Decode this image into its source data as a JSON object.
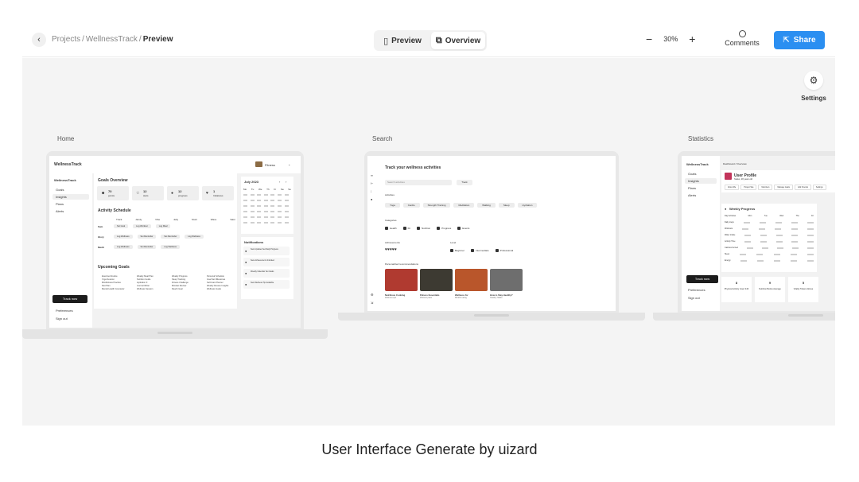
{
  "toolbar": {
    "breadcrumb": [
      "Projects",
      "WellnessTrack",
      "Preview"
    ],
    "separator": "/",
    "tabs": [
      {
        "label": "Preview",
        "icon": "phone-icon"
      },
      {
        "label": "Overview",
        "icon": "copy-icon"
      }
    ],
    "active_tab": "Overview",
    "zoom": "30%",
    "comments_label": "Comments",
    "share_label": "Share",
    "accent": "#2b8ff1"
  },
  "canvas": {
    "settings_label": "Settings",
    "frames": [
      {
        "label": "Home"
      },
      {
        "label": "Search"
      },
      {
        "label": "Statistics"
      }
    ]
  },
  "home": {
    "app_name": "WellnessTrack",
    "user": "Fitness",
    "nav": [
      "Goals",
      "Insights",
      "Plans",
      "Alerts"
    ],
    "goals_overview": "Goals Overview",
    "stats": [
      {
        "value": "70",
        "label": "points"
      },
      {
        "value": "12",
        "label": "stars"
      },
      {
        "value": "12",
        "label": "progress"
      },
      {
        "value": "1",
        "label": "Initiatives"
      }
    ],
    "calendar_title": "July 2023",
    "weekdays": [
      "Mo",
      "Tu",
      "We",
      "Th",
      "Fr",
      "Sa",
      "Su"
    ],
    "activity_schedule": "Activity Schedule",
    "schedule_cols": [
      "Track",
      "Jandy",
      "Vibe",
      "Jelly",
      "Stunt",
      "Wave",
      "Valor"
    ],
    "schedule_rows": [
      {
        "day": "Sam",
        "items": [
          "Set Goal",
          "Log Workout",
          "Log Meal"
        ]
      },
      {
        "day": "Glory",
        "items": [
          "Log Wellness",
          "Set Reminder",
          "Set Reminder",
          "Log Wellness"
        ]
      },
      {
        "day": "Medit",
        "items": [
          "Log Wellness",
          "Set Reminder",
          "Log Wellness"
        ]
      }
    ],
    "notifications": "Notifications",
    "notification_items": [
      "New Updates Set Daily Progress",
      "New Achievement Unlocked",
      "Weekly Calendar Set Goals",
      "New Wellness Tip Available"
    ],
    "upcoming_goals": "Upcoming Goals",
    "goals_cols": [
      [
        "Exercise Routine",
        "Yoga Session",
        "Mindfulness Practice",
        "Diet Plan",
        "Mental Health Counselor"
      ],
      [
        "Weekly Meal Plan",
        "Nutrition Guide",
        "Hydration F",
        "Journal Writer",
        "Wellness Session"
      ],
      [
        "Weekly Progress",
        "Sleep Tracking",
        "Fitness Challenge",
        "Mindset Review",
        "Reach Goal"
      ],
      [
        "Personal Schedule",
        "Goal Set Milestones",
        "Self-Care Planner",
        "Weekly Review Insights",
        "Wellness Goals"
      ]
    ],
    "track_button": "Track now",
    "footer_nav": [
      "Preferences",
      "Sign out"
    ]
  },
  "search": {
    "title": "Track your wellness activities",
    "search_placeholder": "Search activities",
    "search_button": "Track",
    "section_activities": "Activities",
    "activities": [
      "Yoga",
      "Cardio",
      "Strength Training",
      "Meditation",
      "Walking",
      "Sleep",
      "Hydration"
    ],
    "section_categories": "Categories",
    "categories": [
      "Health",
      "Fit",
      "Nutrition",
      "Progress",
      "Events"
    ],
    "section_achievements": "Achievements",
    "section_level": "Level",
    "levels": [
      "Beginner",
      "Intermediate",
      "Professional"
    ],
    "section_recommended": "Personalized recommendations",
    "cards": [
      {
        "title": "Nutritious Cooking",
        "sub": "Wellness tips",
        "color": "#b03a30"
      },
      {
        "title": "Fitness Essentials",
        "sub": "Workout plans",
        "color": "#3d3a32"
      },
      {
        "title": "Wellness for",
        "sub": "Mindful eating",
        "color": "#b9562b"
      },
      {
        "title": "How to Stay Healthy?",
        "sub": "Healthy Habits",
        "color": "#6e6e6e"
      }
    ]
  },
  "stats": {
    "app_name": "WellnessTrack",
    "nav": [
      "Goals",
      "Insights",
      "Plans",
      "Alerts"
    ],
    "breadcrumb": "Dashboard / Overview",
    "profile_title": "User Profile",
    "profile_sub": "Status, 28 years old",
    "profile_tabs": [
      "About Me",
      "Project Site",
      "Members",
      "Manage Goals",
      "Add Friends",
      "Settings"
    ],
    "weekly_title": "Weekly Progress",
    "weekly_cols": [
      "Day Activities",
      "Mon",
      "Tue",
      "Wed",
      "Thu",
      "Fri"
    ],
    "weekly_rows": [
      "Daily steps",
      "Workouts",
      "Water intake",
      "Activity Time",
      "Calories burned",
      "Sleep",
      "Energy"
    ],
    "cards": [
      {
        "value": "8",
        "label": "Physical Activity Goal: 440"
      },
      {
        "value": "9",
        "label": "Nutrition Below Average"
      },
      {
        "value": "5",
        "label": "Vitality Tokens Above"
      }
    ],
    "track_button": "Track now",
    "footer_nav": [
      "Preferences",
      "Sign out"
    ]
  },
  "caption": "User Interface Generate by uizard"
}
